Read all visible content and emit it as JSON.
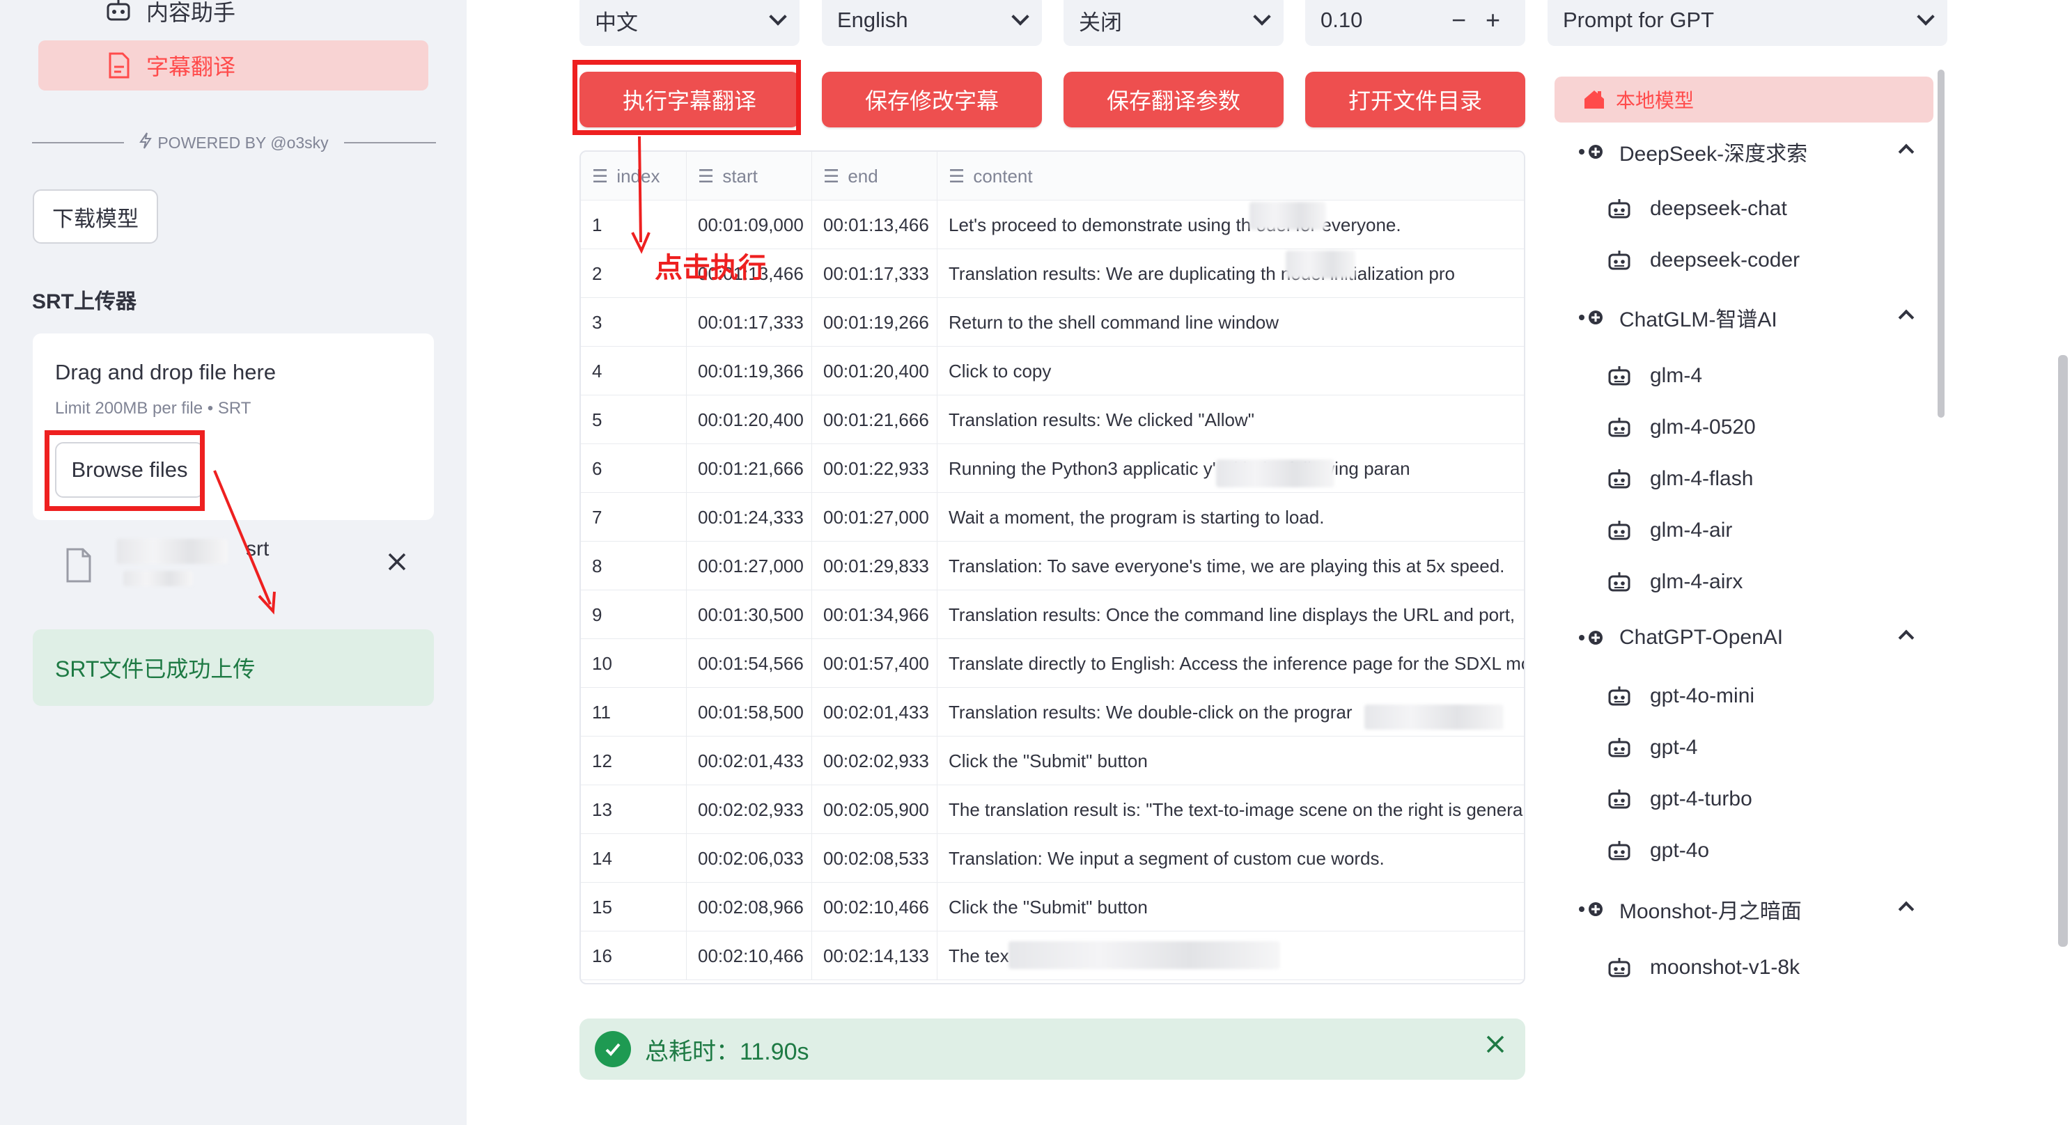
{
  "sidebar": {
    "nav": [
      {
        "label": "内容助手",
        "icon": "robot-icon",
        "active": false
      },
      {
        "label": "字幕翻译",
        "icon": "document-icon",
        "active": true
      }
    ],
    "powered_by": "POWERED BY @o3sky",
    "download_button": "下载模型",
    "uploader_title": "SRT上传器",
    "dropzone": {
      "title": "Drag and drop file here",
      "limit": "Limit 200MB per file • SRT",
      "browse_button": "Browse files"
    },
    "uploaded_file": {
      "name_suffix": "srt"
    },
    "success_message": "SRT文件已成功上传"
  },
  "controls": {
    "source_lang": "中文",
    "target_lang": "English",
    "toggle": "关闭",
    "temperature": "0.10",
    "minus": "−",
    "plus": "+",
    "prompt": "Prompt for GPT"
  },
  "actions": {
    "run": "执行字幕翻译",
    "save_subtitles": "保存修改字幕",
    "save_params": "保存翻译参数",
    "open_dir": "打开文件目录"
  },
  "table": {
    "columns": [
      "index",
      "start",
      "end",
      "content"
    ],
    "rows": [
      {
        "index": "1",
        "start": "00:01:09,000",
        "end": "00:01:13,466",
        "content": "Let's proceed to demonstrate using th          odel for everyone."
      },
      {
        "index": "2",
        "start": "00:01:13,466",
        "end": "00:01:17,333",
        "content": "Translation results: We are duplicating th           nodel initialization pro"
      },
      {
        "index": "3",
        "start": "00:01:17,333",
        "end": "00:01:19,266",
        "content": "Return to the shell command line window"
      },
      {
        "index": "4",
        "start": "00:01:19,366",
        "end": "00:01:20,400",
        "content": "Click to copy"
      },
      {
        "index": "5",
        "start": "00:01:20,400",
        "end": "00:01:21,666",
        "content": "Translation results: We clicked \"Allow\""
      },
      {
        "index": "6",
        "start": "00:01:21,666",
        "end": "00:01:22,933",
        "content": "Running the Python3 applicatic                 y' with the following paran"
      },
      {
        "index": "7",
        "start": "00:01:24,333",
        "end": "00:01:27,000",
        "content": "Wait a moment, the program is starting to load."
      },
      {
        "index": "8",
        "start": "00:01:27,000",
        "end": "00:01:29,833",
        "content": "Translation: To save everyone's time, we are playing this at 5x speed."
      },
      {
        "index": "9",
        "start": "00:01:30,500",
        "end": "00:01:34,966",
        "content": "Translation results: Once the command line displays the URL and port,"
      },
      {
        "index": "10",
        "start": "00:01:54,566",
        "end": "00:01:57,400",
        "content": "Translate directly to English: Access the inference page for the SDXL mo"
      },
      {
        "index": "11",
        "start": "00:01:58,500",
        "end": "00:02:01,433",
        "content": "Translation results: We double-click on the prograr"
      },
      {
        "index": "12",
        "start": "00:02:01,433",
        "end": "00:02:02,933",
        "content": "Click the \"Submit\" button"
      },
      {
        "index": "13",
        "start": "00:02:02,933",
        "end": "00:02:05,900",
        "content": "The translation result is: \"The text-to-image scene on the right is genera"
      },
      {
        "index": "14",
        "start": "00:02:06,033",
        "end": "00:02:08,533",
        "content": "Translation: We input a segment of custom cue words."
      },
      {
        "index": "15",
        "start": "00:02:08,966",
        "end": "00:02:10,466",
        "content": "Click the \"Submit\" button"
      },
      {
        "index": "16",
        "start": "00:02:10,466",
        "end": "00:02:14,133",
        "content": "The tex                                              \" translates to \"Similar"
      }
    ]
  },
  "timer": {
    "label": "总耗时：11.90s"
  },
  "models": {
    "header": "本地模型",
    "groups": [
      {
        "name": "DeepSeek-深度求索",
        "items": [
          "deepseek-chat",
          "deepseek-coder"
        ]
      },
      {
        "name": "ChatGLM-智谱AI",
        "items": [
          "glm-4",
          "glm-4-0520",
          "glm-4-flash",
          "glm-4-air",
          "glm-4-airx"
        ]
      },
      {
        "name": "ChatGPT-OpenAI",
        "items": [
          "gpt-4o-mini",
          "gpt-4",
          "gpt-4-turbo",
          "gpt-4o"
        ]
      },
      {
        "name": "Moonshot-月之暗面",
        "items": [
          "moonshot-v1-8k"
        ]
      }
    ]
  },
  "annotation": {
    "click_hint": "点击执行"
  },
  "colors": {
    "accent": "#ee4f4f",
    "annotation": "#ee2020",
    "success_bg": "#dfefe6",
    "success_text": "#1e7a44"
  }
}
